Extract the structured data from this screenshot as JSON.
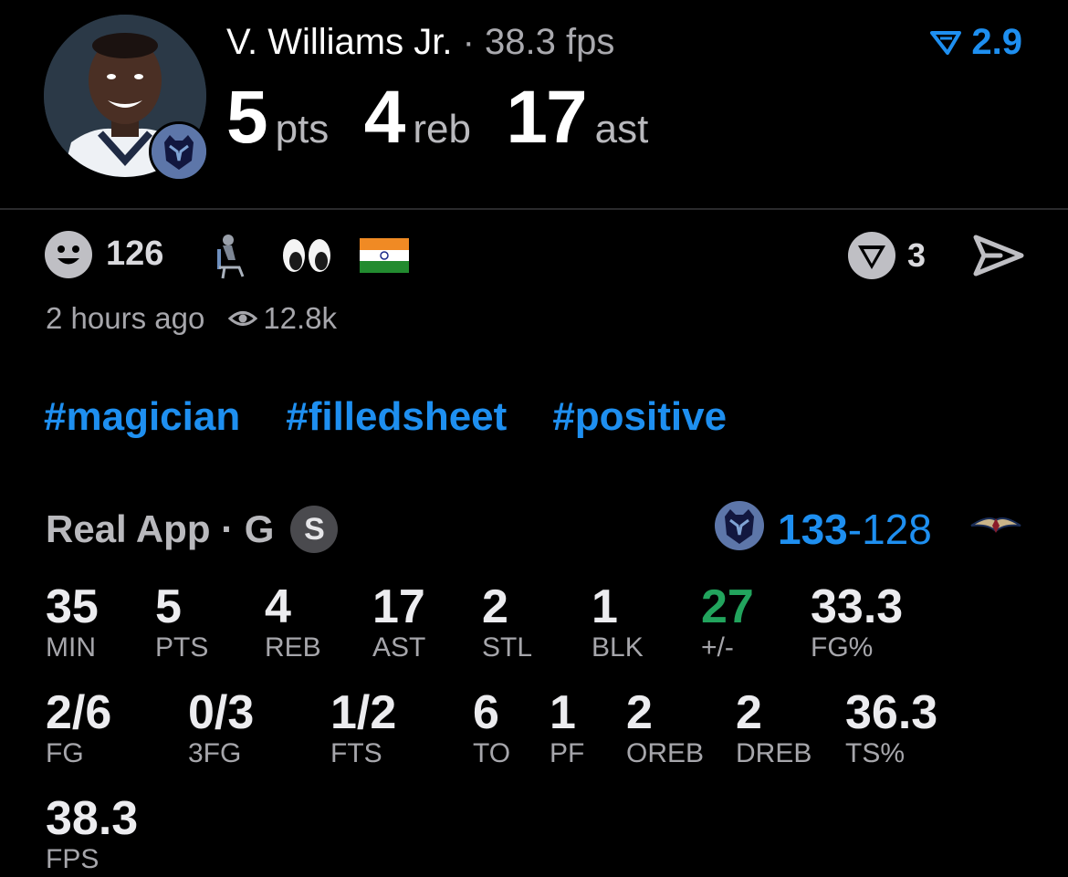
{
  "header": {
    "player_name": "V. Williams Jr.",
    "separator": " · ",
    "fps": "38.3 fps",
    "rating": "2.9",
    "stats": [
      {
        "value": "5",
        "unit": "pts"
      },
      {
        "value": "4",
        "unit": "reb"
      },
      {
        "value": "17",
        "unit": "ast"
      }
    ]
  },
  "reactions": {
    "count": "126",
    "comments": "3",
    "time": "2 hours ago",
    "views": "12.8k"
  },
  "hashtags": [
    "#magician",
    "#filledsheet",
    "#positive"
  ],
  "game": {
    "source": "Real App · G",
    "badge": "S",
    "home_score": "133",
    "dash": "-",
    "away_score": "128"
  },
  "stat_rows": [
    [
      {
        "value": "35",
        "label": "MIN"
      },
      {
        "value": "5",
        "label": "PTS"
      },
      {
        "value": "4",
        "label": "REB"
      },
      {
        "value": "17",
        "label": "AST"
      },
      {
        "value": "2",
        "label": "STL"
      },
      {
        "value": "1",
        "label": "BLK"
      },
      {
        "value": "27",
        "label": "+/-"
      },
      {
        "value": "33.3",
        "label": "FG%"
      }
    ],
    [
      {
        "value": "2/6",
        "label": "FG"
      },
      {
        "value": "0/3",
        "label": "3FG"
      },
      {
        "value": "1/2",
        "label": "FTS"
      },
      {
        "value": "6",
        "label": "TO"
      },
      {
        "value": "1",
        "label": "PF"
      },
      {
        "value": "2",
        "label": "OREB"
      },
      {
        "value": "2",
        "label": "DREB"
      },
      {
        "value": "36.3",
        "label": "TS%"
      }
    ],
    [
      {
        "value": "38.3",
        "label": "FPS"
      }
    ]
  ],
  "colors": {
    "accent": "#1e8ff0",
    "positive": "#22a45d",
    "background": "#000000"
  },
  "icons": {
    "avatar": "player-photo",
    "team": "grizzlies-logo",
    "opponent": "pelicans-logo",
    "rating": "rating-arrow-icon",
    "smile": "smile-icon",
    "comments": "comment-badge-icon",
    "share": "share-icon",
    "views": "eye-icon"
  }
}
